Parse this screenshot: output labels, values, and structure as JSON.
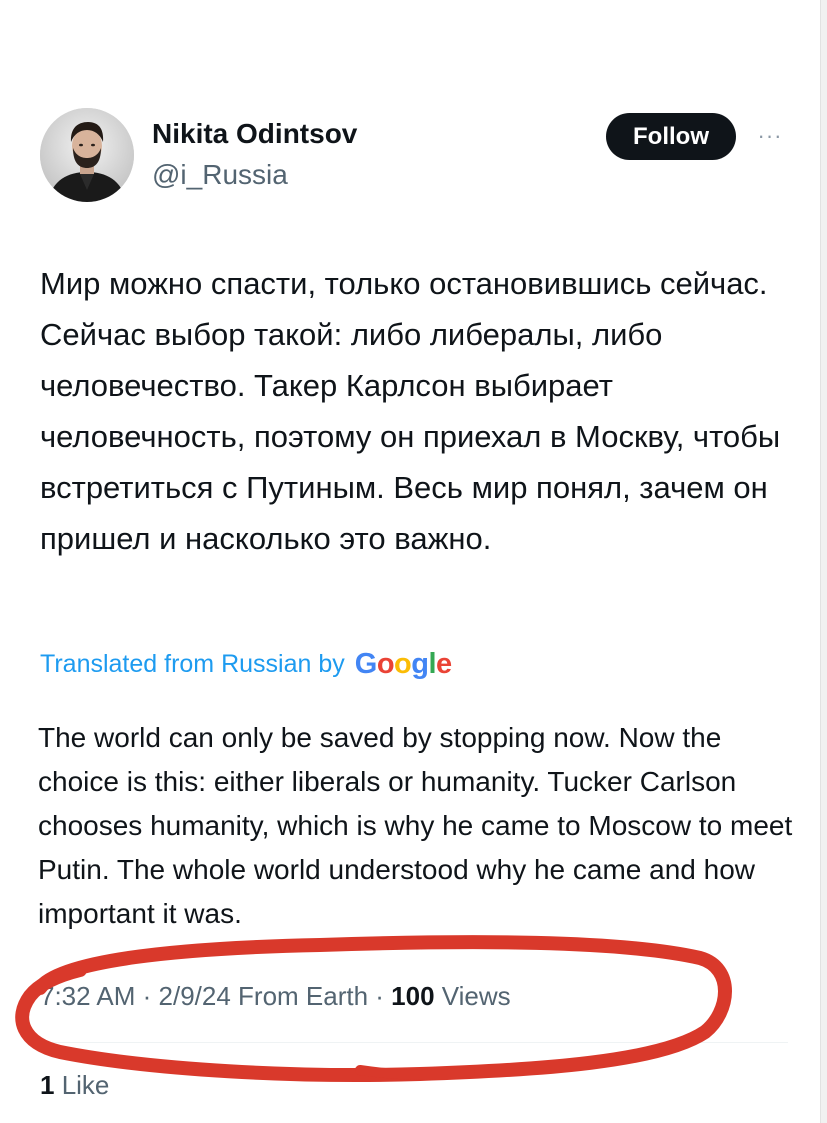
{
  "author": {
    "display_name": "Nikita Odintsov",
    "handle": "@i_Russia"
  },
  "follow_button": {
    "label": "Follow"
  },
  "more_button": {
    "label": "···"
  },
  "tweet": {
    "text": "Мир можно спасти, только остановившись сейчас. Сейчас выбор такой: либо либералы, либо человечество. Такер Карлсон выбирает человечность, поэтому он приехал в Москву, чтобы встретиться с Путиным. Весь мир понял, зачем он пришел и насколько это важно.",
    "translated_label": "Translated from Russian by",
    "translation_provider": "Google",
    "translation": "The world can only be saved by stopping now. Now the choice is this: either liberals or humanity. Tucker Carlson chooses humanity, which is why he came to Moscow to meet Putin. The whole world understood why he came and how important it was."
  },
  "meta": {
    "time": "7:32 AM",
    "separator_1": " · ",
    "date": "2/9/24",
    "location": " From Earth",
    "separator_2": " · ",
    "views_count": "100",
    "views_label": " Views"
  },
  "engagement": {
    "like_count": "1",
    "like_label": " Like"
  },
  "colors": {
    "follow_bg": "#0f1419",
    "link": "#1d9bf0",
    "secondary_text": "#536471",
    "annotation_red": "#d9392b"
  }
}
